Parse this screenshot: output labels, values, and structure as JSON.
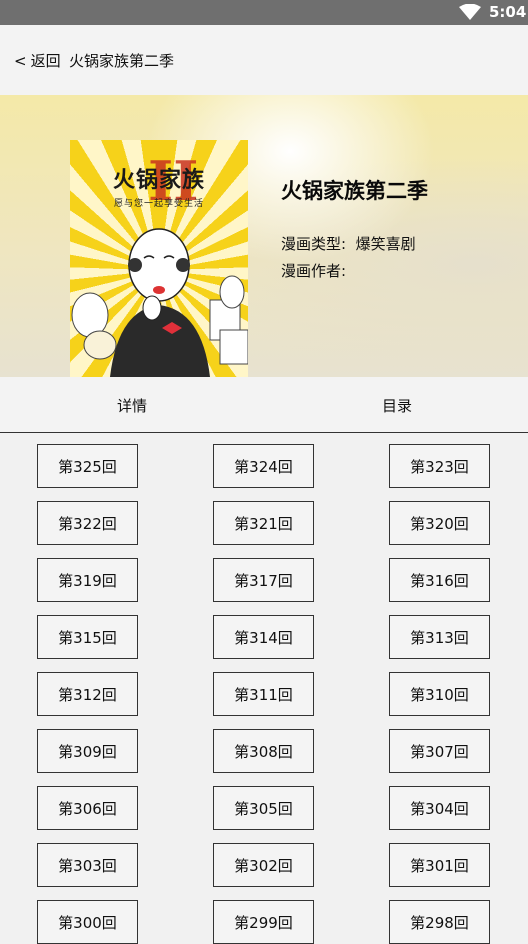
{
  "status_bar": {
    "time": "5:04",
    "wifi_icon": "wifi-icon"
  },
  "header": {
    "back_label": "返回",
    "title": "火锅家族第二季"
  },
  "comic": {
    "cover_title": "火锅家族",
    "cover_subtitle": "愿与您一起享受生活",
    "cover_numeral": "II",
    "title": "火锅家族第二季",
    "type_label": "漫画类型:",
    "type_value": "爆笑喜剧",
    "author_label": "漫画作者:",
    "author_value": ""
  },
  "tabs": [
    {
      "label": "详情"
    },
    {
      "label": "目录"
    }
  ],
  "episodes": [
    "第325回",
    "第324回",
    "第323回",
    "第322回",
    "第321回",
    "第320回",
    "第319回",
    "第317回",
    "第316回",
    "第315回",
    "第314回",
    "第313回",
    "第312回",
    "第311回",
    "第310回",
    "第309回",
    "第308回",
    "第307回",
    "第306回",
    "第305回",
    "第304回",
    "第303回",
    "第302回",
    "第301回",
    "第300回",
    "第299回",
    "第298回"
  ]
}
